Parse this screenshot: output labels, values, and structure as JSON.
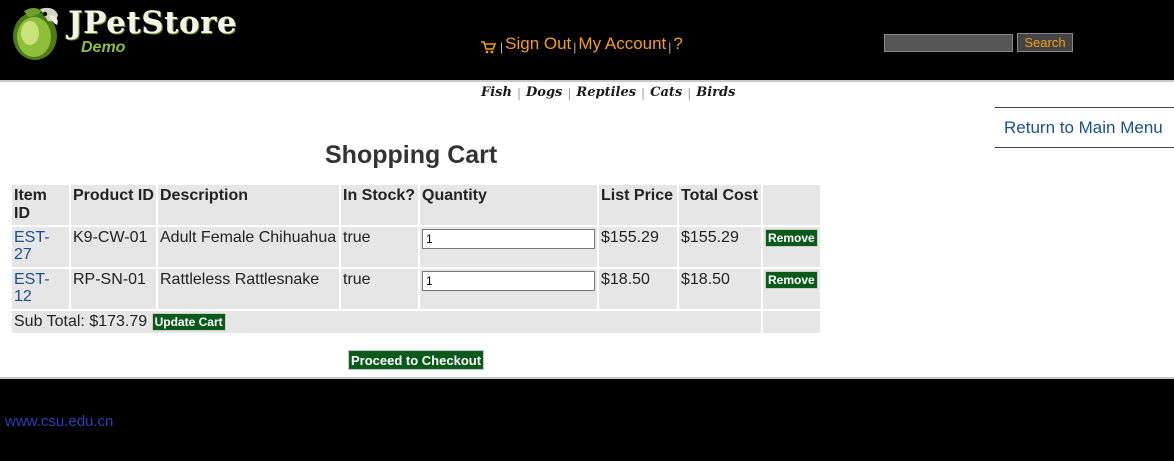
{
  "header": {
    "logo_title": "JPetStore",
    "logo_subtitle": "Demo",
    "menu": {
      "cart_icon": "cart-icon",
      "sign_out": "Sign Out",
      "my_account": "My Account",
      "help": "?"
    },
    "search": {
      "value": "",
      "button_label": "Search"
    }
  },
  "quick_links": [
    "Fish",
    "Dogs",
    "Reptiles",
    "Cats",
    "Birds"
  ],
  "return_link": "Return to Main Menu",
  "cart": {
    "title": "Shopping Cart",
    "columns": [
      "Item ID",
      "Product ID",
      "Description",
      "In Stock?",
      "Quantity",
      "List Price",
      "Total Cost",
      ""
    ],
    "rows": [
      {
        "item_id": "EST-27",
        "product_id": "K9-CW-01",
        "description": "Adult Female Chihuahua",
        "in_stock": "true",
        "quantity": "1",
        "list_price": "$155.29",
        "total_cost": "$155.29",
        "remove_label": "Remove"
      },
      {
        "item_id": "EST-12",
        "product_id": "RP-SN-01",
        "description": "Rattleless Rattlesnake",
        "in_stock": "true",
        "quantity": "1",
        "list_price": "$18.50",
        "total_cost": "$18.50",
        "remove_label": "Remove"
      }
    ],
    "subtotal_label": "Sub Total: $173.79",
    "update_label": "Update Cart",
    "checkout_label": "Proceed to Checkout"
  },
  "footer": {
    "link": "www.csu.edu.cn"
  },
  "colors": {
    "header_bg": "#000000",
    "menu_link": "#f29f1e",
    "button_green": "#0b5a1c",
    "link_blue": "#1d4f8a",
    "table_cell": "#e6e6e6"
  }
}
